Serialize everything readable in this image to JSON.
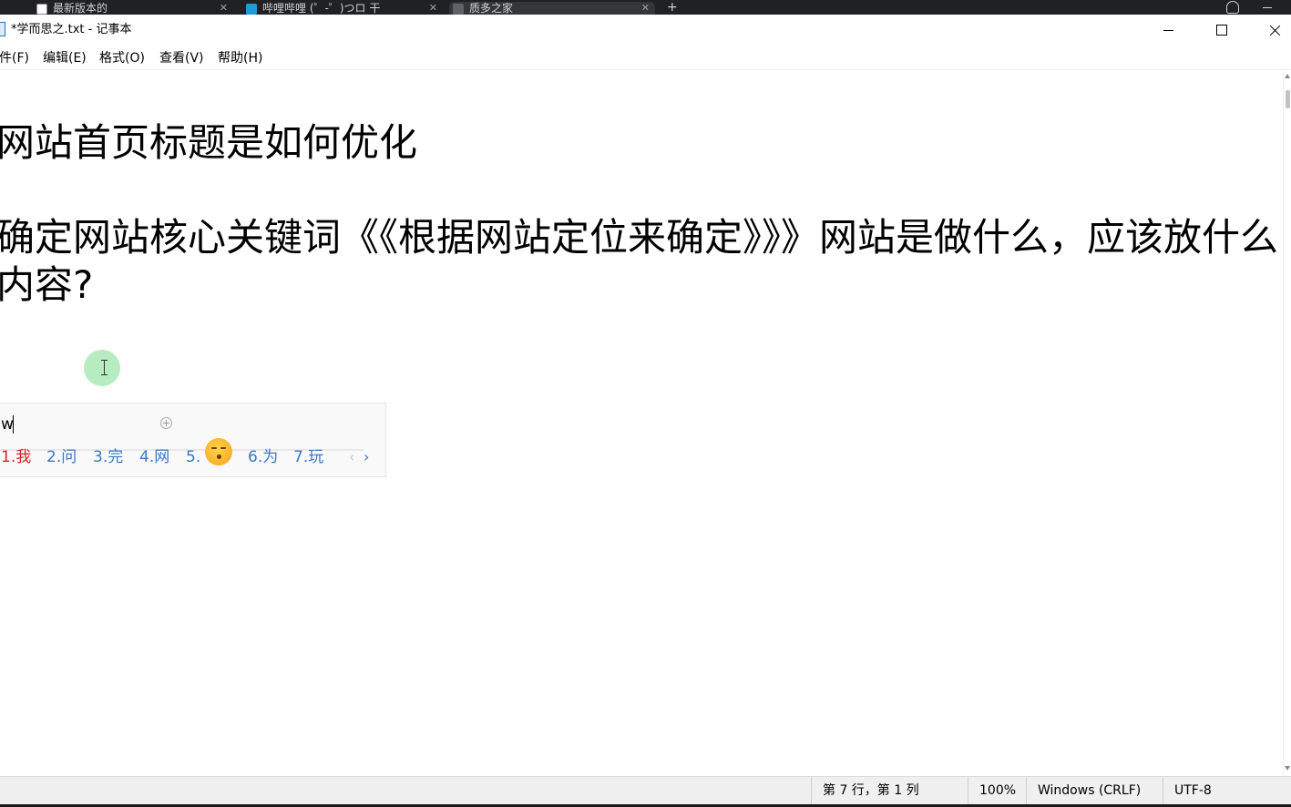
{
  "browser": {
    "tabs": [
      {
        "label": "最新版本的"
      },
      {
        "label": "哔哩哔哩 (゜-゜)つロ 干"
      },
      {
        "label": "质多之家"
      }
    ],
    "new_tab_label": "+"
  },
  "window": {
    "title": "*学而思之.txt - 记事本"
  },
  "menu": [
    "件(F)",
    "编辑(E)",
    "格式(O)",
    "查看(V)",
    "帮助(H)"
  ],
  "editor": {
    "lines": [
      "网站首页标题是如何优化",
      "确定网站核心关键词《《根据网站定位来确定》》》网站是做什么，应该放什么",
      "内容?"
    ]
  },
  "ime": {
    "composition": "w",
    "candidates": [
      "1.我",
      "2.问",
      "3.完",
      "4.网",
      "5.",
      "6.为",
      "7.玩"
    ],
    "emoji": "kissing-face",
    "prev_label": "‹",
    "next_label": "›"
  },
  "status": {
    "position": "第 7 行，第 1 列",
    "zoom": "100%",
    "line_ending": "Windows (CRLF)",
    "encoding": "UTF-8"
  }
}
